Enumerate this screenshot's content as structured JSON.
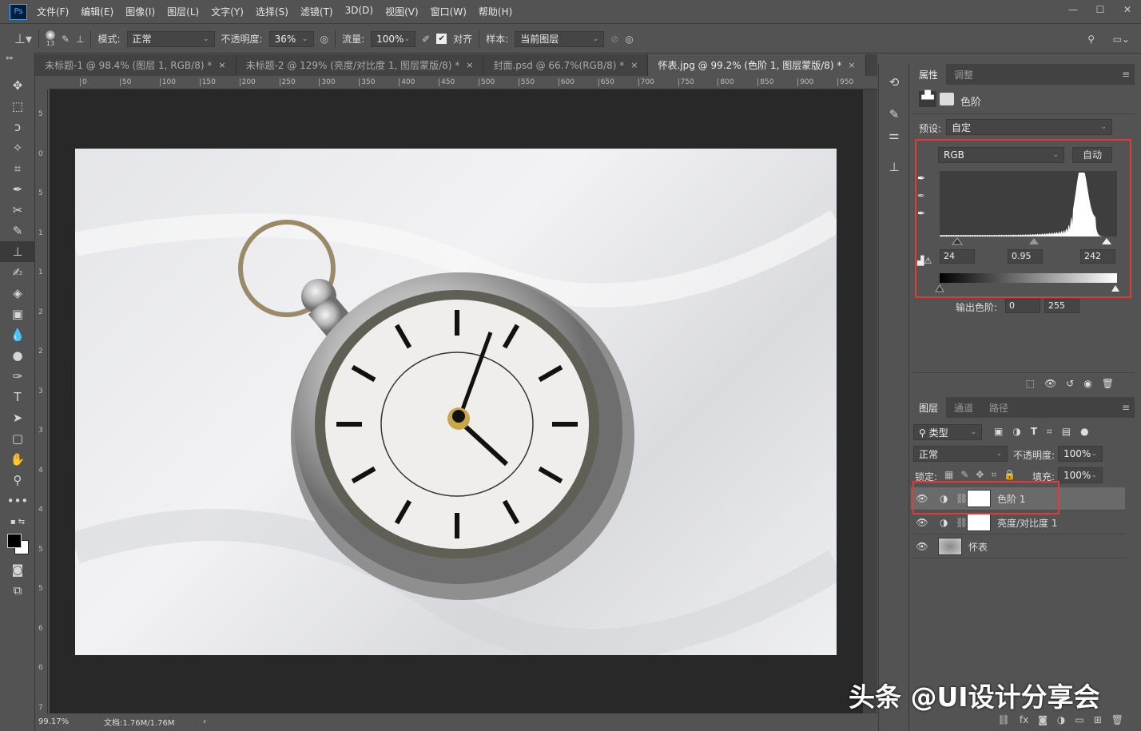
{
  "app": {
    "logo": "Ps"
  },
  "menu": [
    "文件(F)",
    "编辑(E)",
    "图像(I)",
    "图层(L)",
    "文字(Y)",
    "选择(S)",
    "滤镜(T)",
    "3D(D)",
    "视图(V)",
    "窗口(W)",
    "帮助(H)"
  ],
  "window_controls": [
    "—",
    "☐",
    "✕"
  ],
  "options": {
    "brush_size": "13",
    "mode_label": "模式:",
    "mode_value": "正常",
    "opacity_label": "不透明度:",
    "opacity_value": "36%",
    "flow_label": "流量:",
    "flow_value": "100%",
    "align_label": "对齐",
    "align_checked": true,
    "sample_label": "样本:",
    "sample_value": "当前图层"
  },
  "tabs": [
    {
      "label": "未标题-1 @ 98.4% (图层 1, RGB/8) *",
      "active": false
    },
    {
      "label": "未标题-2 @ 129% (亮度/对比度 1, 图层蒙版/8) *",
      "active": false
    },
    {
      "label": "封面.psd @ 66.7%(RGB/8) *",
      "active": false
    },
    {
      "label": "怀表.jpg @ 99.2% (色阶 1, 图层蒙版/8) *",
      "active": true
    }
  ],
  "tab_close": "×",
  "ruler_top": [
    "0",
    "50",
    "100",
    "150",
    "200",
    "250",
    "300",
    "350",
    "400",
    "450",
    "500",
    "550",
    "600",
    "650",
    "700",
    "750",
    "800",
    "850",
    "900",
    "950"
  ],
  "ruler_left": [
    "5",
    "0",
    "5",
    "1",
    "1",
    "2",
    "2",
    "3",
    "3",
    "4",
    "4",
    "5",
    "5",
    "6",
    "6",
    "7"
  ],
  "status": {
    "zoom": "99.17%",
    "doc": "文档:1.76M/1.76M",
    "arrow": "›"
  },
  "properties": {
    "tabs": [
      "属性",
      "调整"
    ],
    "title": "色阶",
    "preset_label": "预设:",
    "preset_value": "自定",
    "channel": "RGB",
    "auto_button": "自动",
    "input_black": "24",
    "input_gamma": "0.95",
    "input_white": "242",
    "output_label": "输出色阶:",
    "output_black": "0",
    "output_white": "255"
  },
  "layers": {
    "tabs": [
      "图层",
      "通道",
      "路径"
    ],
    "filter": "类型",
    "blend_mode": "正常",
    "opacity_label": "不透明度:",
    "opacity_value": "100%",
    "lock_label": "锁定:",
    "fill_label": "填充:",
    "fill_value": "100%",
    "items": [
      {
        "name": "色阶 1",
        "type": "adjustment",
        "selected": true
      },
      {
        "name": "亮度/对比度 1",
        "type": "adjustment",
        "selected": false
      },
      {
        "name": "怀表",
        "type": "image",
        "selected": false
      }
    ]
  },
  "watermark": "头条 @UI设计分享会"
}
